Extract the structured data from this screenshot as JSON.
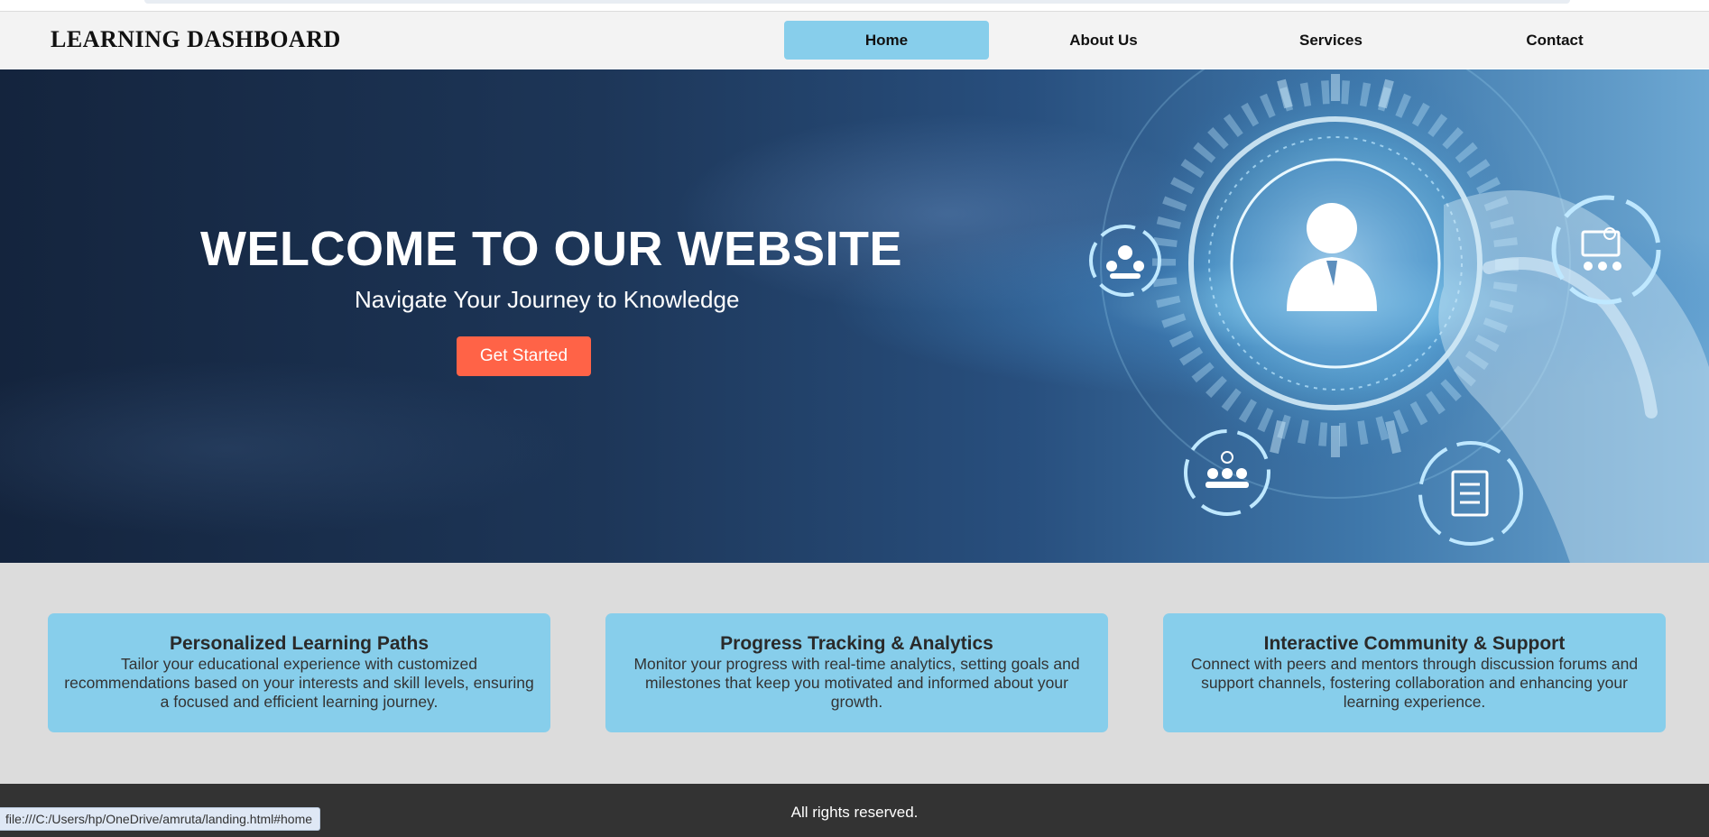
{
  "header": {
    "brand": "LEARNING DASHBOARD",
    "nav": [
      {
        "label": "Home",
        "active": true
      },
      {
        "label": "About Us"
      },
      {
        "label": "Services"
      },
      {
        "label": "Contact"
      }
    ]
  },
  "hero": {
    "title": "WELCOME TO OUR WEBSITE",
    "subtitle": "Navigate Your Journey to Knowledge",
    "cta_label": "Get Started"
  },
  "features": [
    {
      "title": "Personalized Learning Paths",
      "text": "Tailor your educational experience with customized recommendations based on your interests and skill levels, ensuring a focused and efficient learning journey."
    },
    {
      "title": "Progress Tracking & Analytics",
      "text": "Monitor your progress with real-time analytics, setting goals and milestones that keep you motivated and informed about your growth."
    },
    {
      "title": "Interactive Community & Support",
      "text": "Connect with peers and mentors through discussion forums and support channels, fostering collaboration and enhancing your learning experience."
    }
  ],
  "footer": {
    "text": "All rights reserved."
  },
  "statusbar": {
    "url": "file:///C:/Users/hp/OneDrive/amruta/landing.html#home"
  },
  "colors": {
    "nav_active": "#87ceeb",
    "cta": "#ff6347",
    "card": "#87ceeb",
    "features_bg": "#dcdcdc",
    "footer_bg": "#333333"
  },
  "icons": [
    "person-icon",
    "group-search-icon",
    "presentation-icon",
    "team-check-icon",
    "document-checklist-icon"
  ]
}
